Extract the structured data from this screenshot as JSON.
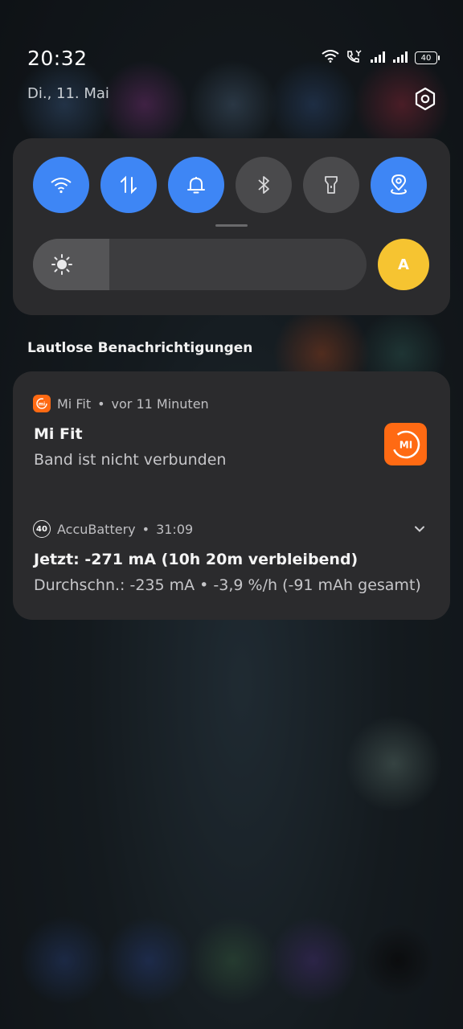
{
  "status": {
    "time": "20:32",
    "date": "Di., 11. Mai",
    "battery_level": "40",
    "icons": [
      "wifi-icon",
      "volte-call-icon",
      "signal-1-icon",
      "signal-2-icon",
      "battery-icon"
    ]
  },
  "quick_settings": {
    "tiles": [
      {
        "name": "wifi",
        "icon": "wifi-icon",
        "active": true
      },
      {
        "name": "mobile-data",
        "icon": "data-transfer-icon",
        "active": true
      },
      {
        "name": "sound",
        "icon": "bell-icon",
        "active": true
      },
      {
        "name": "bluetooth",
        "icon": "bluetooth-icon",
        "active": false
      },
      {
        "name": "flashlight",
        "icon": "flashlight-icon",
        "active": false
      },
      {
        "name": "location",
        "icon": "location-icon",
        "active": true
      }
    ],
    "brightness_level": 0.23,
    "auto_brightness_label": "A",
    "colors": {
      "active": "#3e86f5",
      "inactive": "#4a4a4c",
      "auto": "#f6c431"
    }
  },
  "section_title": "Lautlose Benachrichtigungen",
  "notifications": {
    "mifit": {
      "app": "Mi Fit",
      "separator": "•",
      "time": "vor 11 Minuten",
      "title": "Mi Fit",
      "text": "Band ist nicht verbunden",
      "icon_label": "MI",
      "accent": "#ff6a13"
    },
    "accubattery": {
      "app": "AccuBattery",
      "separator": "•",
      "time": "31:09",
      "icon_label": "40",
      "title": "Jetzt: -271 mA (10h 20m verbleibend)",
      "text": "Durchschn.: -235 mA • -3,9 %/h (-91 mAh gesamt)"
    }
  }
}
